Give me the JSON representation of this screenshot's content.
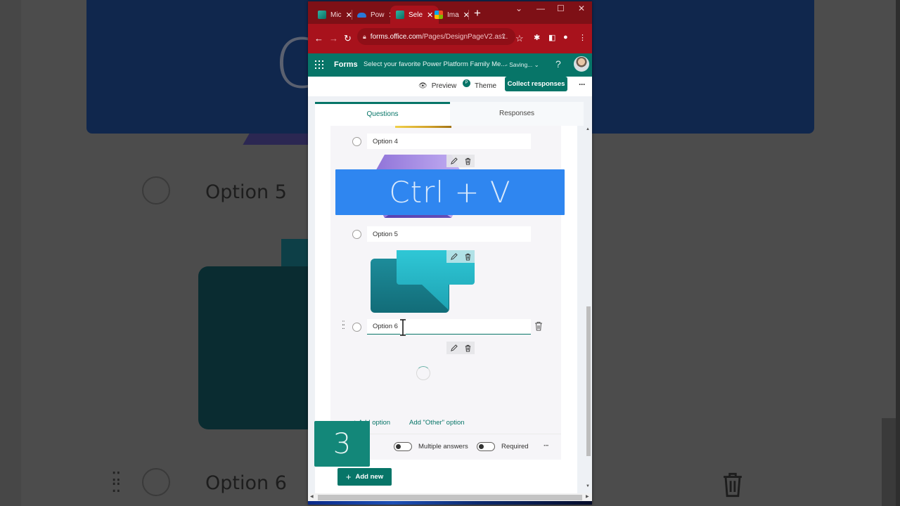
{
  "background": {
    "ctrlv_text": "Ctrl + V",
    "option5": "Option 5",
    "option6": "Option 6"
  },
  "browser": {
    "tabs": [
      {
        "label": "Mic",
        "icon": "forms-icon",
        "active": false
      },
      {
        "label": "Pow",
        "icon": "onedrive-icon",
        "active": false
      },
      {
        "label": "Sele",
        "icon": "forms-icon",
        "active": true
      },
      {
        "label": "Ima",
        "icon": "microsoft-icon",
        "active": false
      }
    ],
    "new_tab": "+",
    "url_host": "forms.office.com",
    "url_path": "/Pages/DesignPageV2.as...",
    "window_controls": {
      "dropdown": "⌄",
      "minimize": "—",
      "maximize": "☐",
      "close": "✕"
    }
  },
  "forms_header": {
    "app_name": "Forms",
    "form_title": "Select your favorite Power Platform Family Me...",
    "status": "- Saving...",
    "help": "?"
  },
  "toolbar": {
    "preview": "Preview",
    "theme": "Theme",
    "theme_badge": "P",
    "collect": "Collect responses",
    "more": "···"
  },
  "tabs": {
    "questions": "Questions",
    "responses": "Responses"
  },
  "question": {
    "options": [
      {
        "label": "Option 4",
        "has_image": true
      },
      {
        "label": "Option 5",
        "has_image": true
      },
      {
        "label": "Option 6",
        "has_image": false,
        "loading": true
      }
    ],
    "add_option": "+ Add option",
    "add_other": "Add \"Other\" option",
    "multiple_answers": {
      "label": "Multiple answers",
      "on": false
    },
    "required": {
      "label": "Required",
      "on": false
    },
    "more": "···"
  },
  "add_new": "Add new",
  "overlay": {
    "shortcut": "Ctrl + V",
    "step": "3"
  },
  "colors": {
    "forms_teal": "#077568",
    "browser_red": "#a8121c",
    "shortcut_blue": "#2f86f0",
    "step_badge": "#138779"
  }
}
